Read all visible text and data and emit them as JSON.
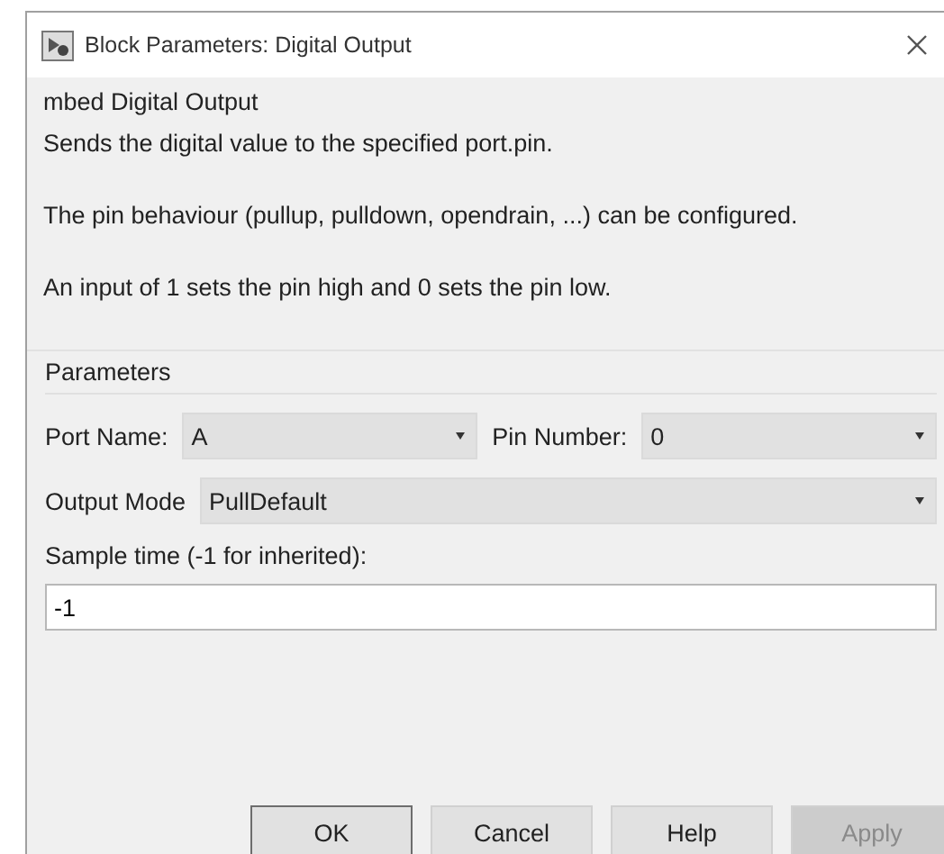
{
  "window": {
    "title": "Block Parameters: Digital Output"
  },
  "description": {
    "heading": "mbed Digital Output",
    "paragraphs": [
      "Sends the digital value to the specified port.pin.",
      "The pin behaviour (pullup, pulldown, opendrain, ...) can be configured.",
      "An input of 1 sets the pin high and 0 sets the pin low."
    ]
  },
  "parameters": {
    "title": "Parameters",
    "rows": [
      [
        {
          "kind": "dropdown",
          "label": "Port Name:",
          "value": "A"
        },
        {
          "kind": "dropdown",
          "label": "Pin Number:",
          "value": "0"
        }
      ],
      [
        {
          "kind": "dropdown",
          "label": "Output Mode",
          "value": "PullDefault"
        }
      ],
      [
        {
          "kind": "text",
          "label": "Sample time (-1 for inherited):",
          "value": "-1"
        }
      ]
    ]
  },
  "buttons": [
    {
      "label": "OK",
      "default": true,
      "disabled": false
    },
    {
      "label": "Cancel",
      "default": false,
      "disabled": false
    },
    {
      "label": "Help",
      "default": false,
      "disabled": false
    },
    {
      "label": "Apply",
      "default": false,
      "disabled": true
    }
  ]
}
